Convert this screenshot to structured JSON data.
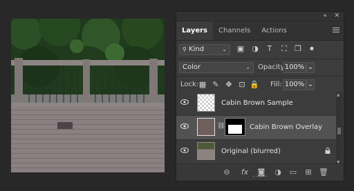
{
  "canvas": {
    "image_icon": "deck-photo"
  },
  "panel": {
    "collapse_icon": "double-chevron-icon",
    "close_icon": "close-icon",
    "tabs": [
      {
        "label": "Layers",
        "active": true
      },
      {
        "label": "Channels",
        "active": false
      },
      {
        "label": "Actions",
        "active": false
      }
    ],
    "filter": {
      "label": "Kind"
    },
    "blend_mode": "Color",
    "opacity_label": "Opacity:",
    "opacity_value": "100%",
    "lock_label": "Lock:",
    "fill_label": "Fill:",
    "fill_value": "100%",
    "layers": [
      {
        "name": "Cabin Brown Sample",
        "selected": false,
        "locked": false
      },
      {
        "name": "Cabin Brown Overlay",
        "selected": true,
        "locked": false
      },
      {
        "name": "Original (blurred)",
        "selected": false,
        "locked": true
      }
    ],
    "bottom_icons": [
      "link-icon",
      "fx-icon",
      "mask-icon",
      "adjustment-icon",
      "folder-icon",
      "new-layer-icon",
      "trash-icon"
    ],
    "fx_label": "fx"
  },
  "colors": {
    "panel_bg": "#3c3c3c",
    "selected_row": "#525252",
    "swatch": "#6e5f5c"
  }
}
